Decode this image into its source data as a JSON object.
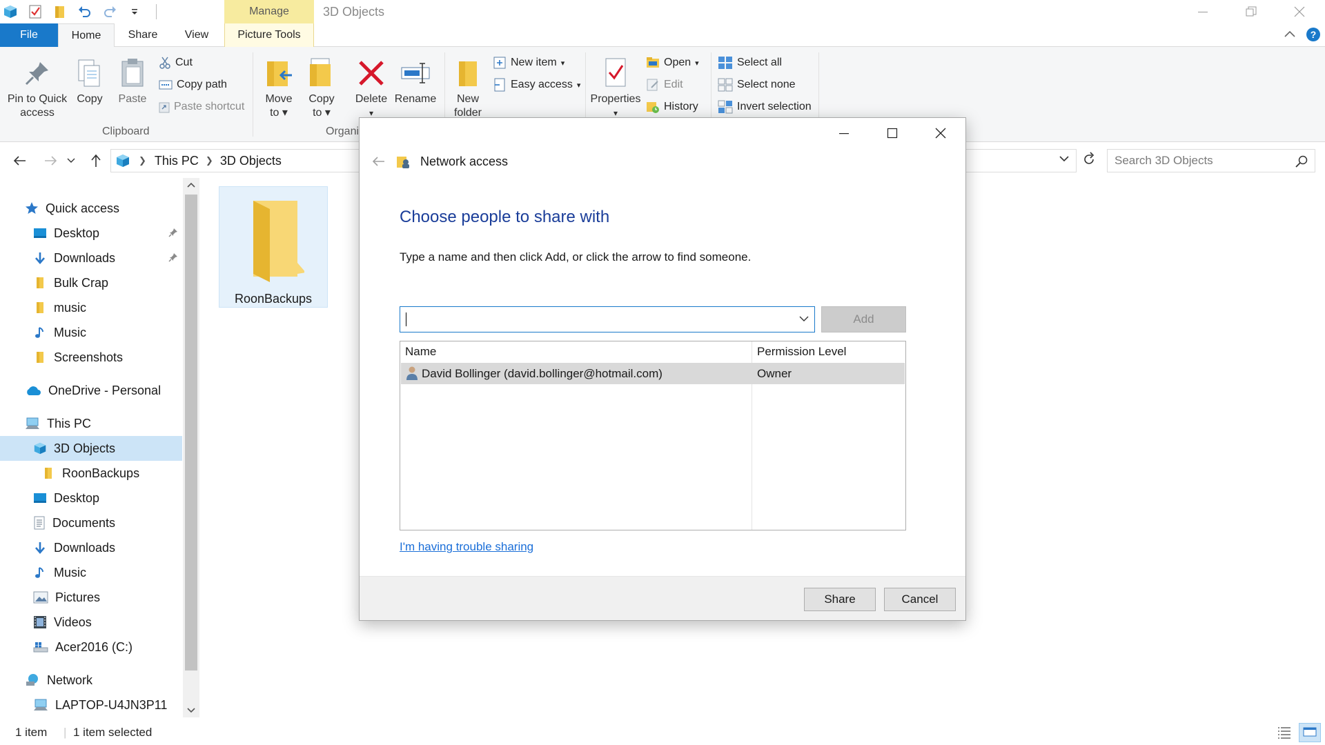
{
  "window": {
    "title": "3D Objects",
    "manage_label": "Manage"
  },
  "tabs": {
    "file": "File",
    "home": "Home",
    "share": "Share",
    "view": "View",
    "picture_tools": "Picture Tools"
  },
  "ribbon": {
    "pin": [
      "Pin to Quick",
      "access"
    ],
    "copy": "Copy",
    "paste": "Paste",
    "cut": "Cut",
    "copy_path": "Copy path",
    "paste_shortcut": "Paste shortcut",
    "clipboard_group": "Clipboard",
    "move_to": [
      "Move",
      "to"
    ],
    "copy_to": [
      "Copy",
      "to"
    ],
    "delete": "Delete",
    "rename": "Rename",
    "organize_group": "Organi",
    "new_folder": [
      "New",
      "folder"
    ],
    "new_item": "New item",
    "easy_access": "Easy access",
    "properties": "Properties",
    "open": "Open",
    "edit": "Edit",
    "history": "History",
    "select_all": "Select all",
    "select_none": "Select none",
    "invert_selection": "Invert selection"
  },
  "address": {
    "crumbs": [
      "This PC",
      "3D Objects"
    ],
    "search_placeholder": "Search 3D Objects"
  },
  "nav": {
    "quick_access": "Quick access",
    "qa_items": [
      "Desktop",
      "Downloads",
      "Bulk Crap",
      "music",
      "Music",
      "Screenshots"
    ],
    "onedrive": "OneDrive - Personal",
    "this_pc": "This PC",
    "pc_items": [
      "3D Objects",
      "RoonBackups",
      "Desktop",
      "Documents",
      "Downloads",
      "Music",
      "Pictures",
      "Videos",
      "Acer2016 (C:)"
    ],
    "network": "Network",
    "network_items": [
      "LAPTOP-U4JN3P11"
    ]
  },
  "content": {
    "files": [
      "RoonBackups"
    ]
  },
  "status": {
    "count": "1 item",
    "selected": "1 item selected"
  },
  "dialog": {
    "title": "Network access",
    "heading": "Choose people to share with",
    "instruction": "Type a name and then click Add, or click the arrow to find someone.",
    "name_input": "",
    "add_label": "Add",
    "col_name": "Name",
    "col_permission": "Permission Level",
    "rows": [
      {
        "name": "David Bollinger (david.bollinger@hotmail.com)",
        "permission": "Owner"
      }
    ],
    "trouble_link": "I'm having trouble sharing",
    "share_label": "Share",
    "cancel_label": "Cancel"
  },
  "colors": {
    "accent": "#1979ca",
    "heading_blue": "#1a3d99",
    "link_blue": "#1a6ed8",
    "folder_yellow": "#f8d775",
    "selection": "#cce4f7"
  }
}
